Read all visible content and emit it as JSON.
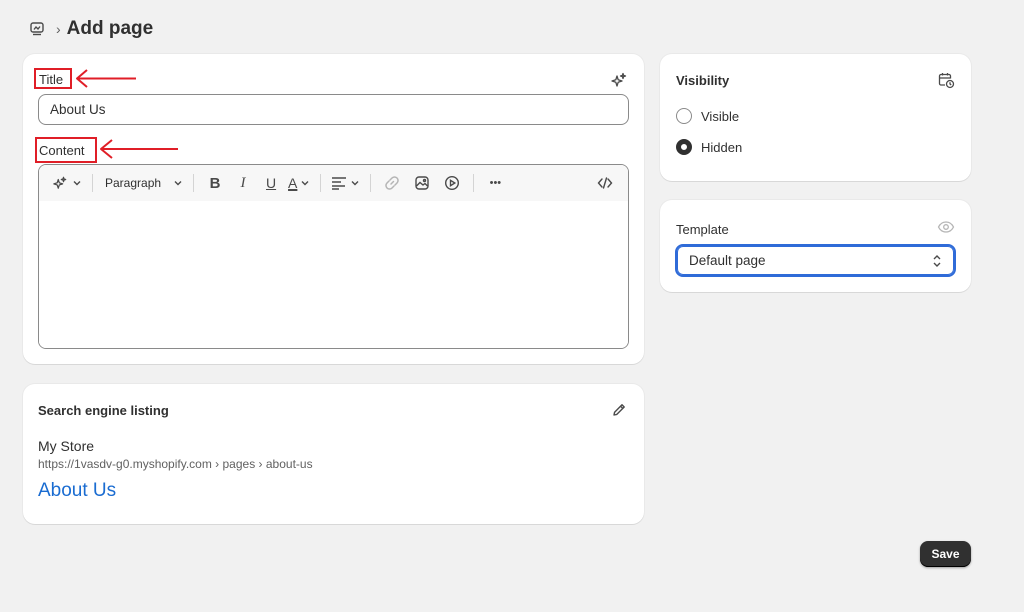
{
  "header": {
    "title": "Add page",
    "separator": "›"
  },
  "main": {
    "title_label": "Title",
    "title_value": "About Us",
    "content_label": "Content",
    "toolbar": {
      "format": "Paragraph",
      "bold": "B",
      "italic": "I",
      "underline": "U",
      "color": "A",
      "more": "•••"
    }
  },
  "seo": {
    "heading": "Search engine listing",
    "store": "My Store",
    "url": "https://1vasdv-g0.myshopify.com › pages › about-us",
    "link": "About Us"
  },
  "visibility": {
    "heading": "Visibility",
    "options": [
      {
        "label": "Visible",
        "checked": false
      },
      {
        "label": "Hidden",
        "checked": true
      }
    ]
  },
  "template": {
    "heading": "Template",
    "selected": "Default page"
  },
  "actions": {
    "save": "Save"
  },
  "colors": {
    "annotation": "#e01e27",
    "focus": "#2f6bd8",
    "link": "#1a6cd1",
    "primary": "#303030"
  }
}
